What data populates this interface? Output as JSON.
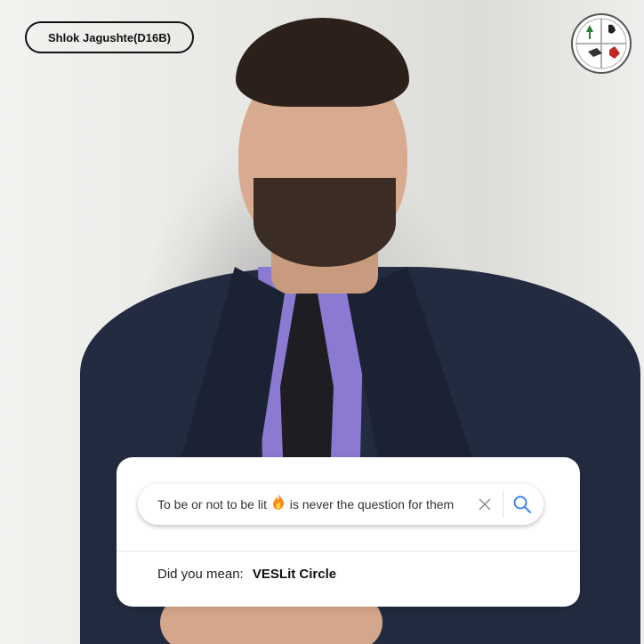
{
  "name_tag": {
    "label": "Shlok Jagushte(D16B)"
  },
  "search": {
    "query_before": "To be or not to be lit",
    "query_after": "is never the question for them",
    "clear_icon": "close-icon",
    "submit_icon": "search-icon",
    "accent_color": "#4285f4"
  },
  "suggestion": {
    "prefix": "Did you mean:",
    "term": "VESLit Circle"
  },
  "logo": {
    "icon": "literary-circle-logo"
  }
}
